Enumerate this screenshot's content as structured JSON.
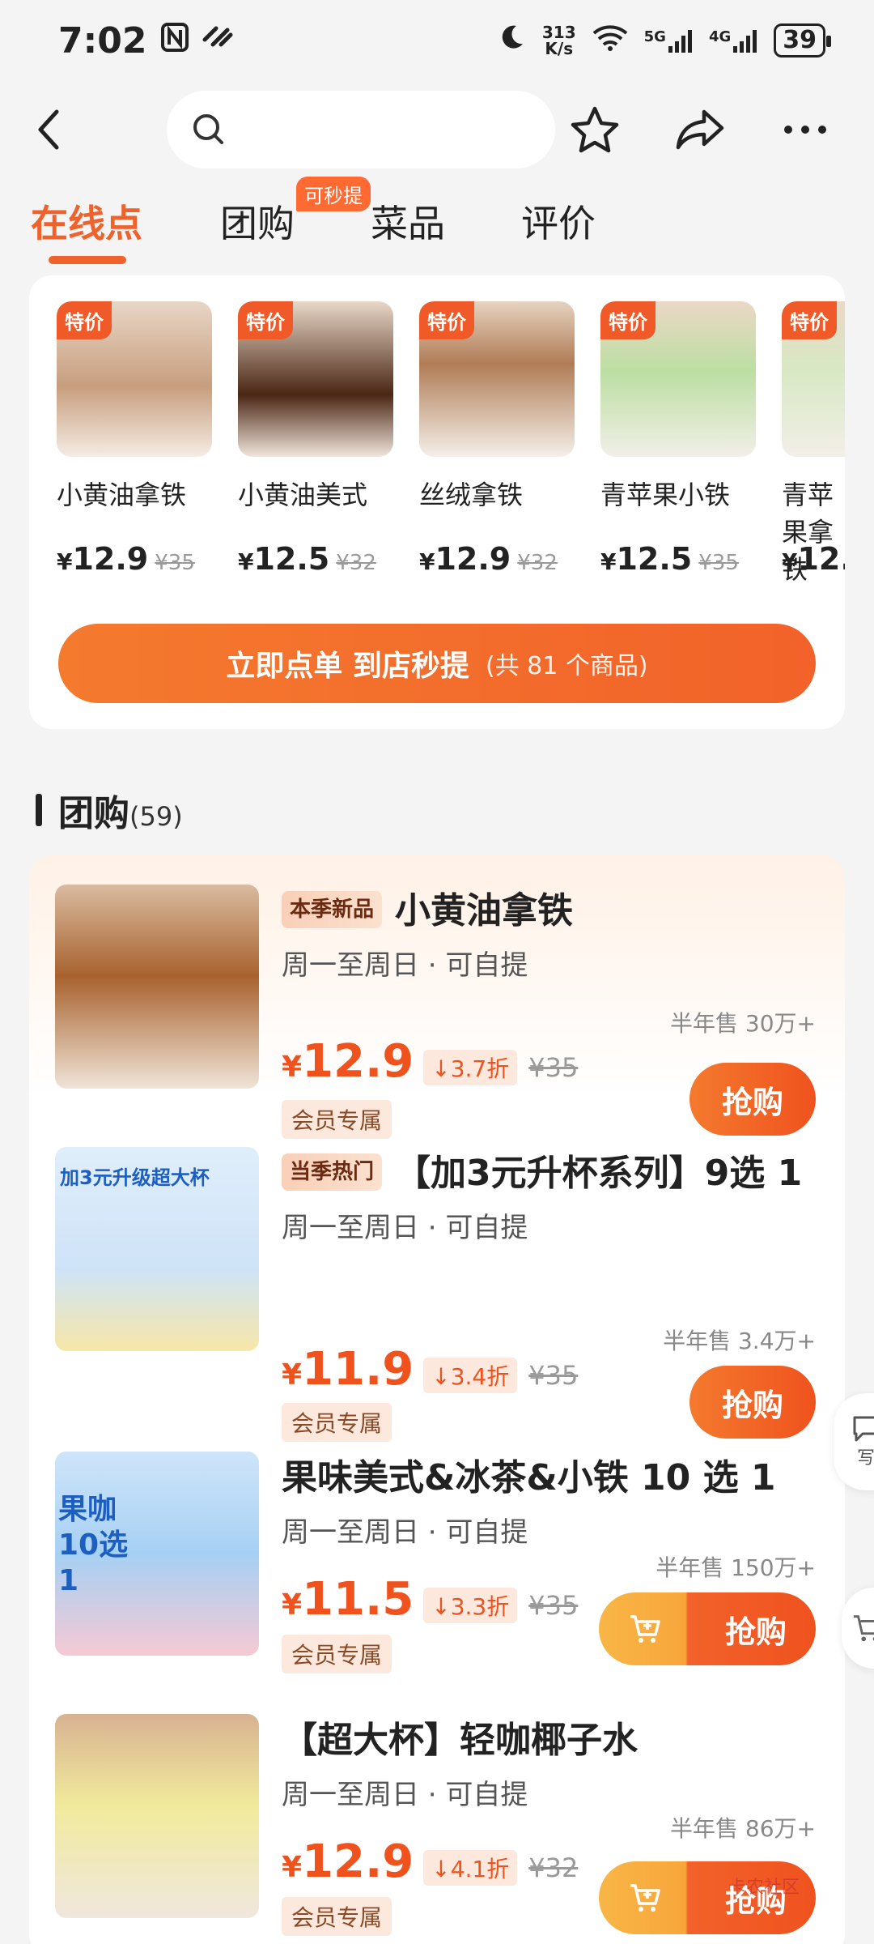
{
  "status": {
    "time": "7:02",
    "net_speed_top": "313",
    "net_speed_bottom": "K/s",
    "sig1": "5G",
    "sig2": "4G",
    "battery": "39"
  },
  "search": {
    "placeholder": ""
  },
  "tabs": [
    {
      "label": "在线点"
    },
    {
      "label": "团购"
    },
    {
      "label": "菜品"
    },
    {
      "label": "评价"
    }
  ],
  "tab_badge": "可秒提",
  "online": {
    "tag": "特价",
    "products": [
      {
        "name": "小黄油拿铁",
        "price": "12.9",
        "old": "¥35",
        "img_color": "#b7733b"
      },
      {
        "name": "小黄油美式",
        "price": "12.5",
        "old": "¥32",
        "img_color": "#6b3a1e"
      },
      {
        "name": "丝绒拿铁",
        "price": "12.9",
        "old": "¥32",
        "img_color": "#c9a98a"
      },
      {
        "name": "青苹果小铁",
        "price": "12.5",
        "old": "¥35",
        "img_color": "#bfe0a4"
      },
      {
        "name": "青苹果拿铁",
        "price": "12.",
        "old": "",
        "img_color": "#d7e7c2"
      }
    ],
    "button_main": "立即点单 到店秒提",
    "button_sub": "(共 81 个商品)"
  },
  "section": {
    "title": "团购",
    "count": "(59)"
  },
  "currency": "¥",
  "deals": [
    {
      "badge": "本季新品",
      "title": "小黄油拿铁",
      "sub": "周一至周日 · 可自提",
      "sold": "半年售 30万+",
      "price": "12.9",
      "discount": "3.7折",
      "old": "¥35",
      "member": "会员专属",
      "buy": "抢购"
    },
    {
      "badge": "当季热门",
      "title": "【加3元升杯系列】9选 1",
      "sub": "周一至周日 · 可自提",
      "sold": "半年售 3.4万+",
      "price": "11.9",
      "discount": "3.4折",
      "old": "¥35",
      "member": "会员专属",
      "buy": "抢购",
      "img_text": "加3元升级超大杯"
    },
    {
      "badge": "",
      "title": "果味美式&冰茶&小铁 10 选 1",
      "sub": "周一至周日 · 可自提",
      "sold": "半年售 150万+",
      "price": "11.5",
      "discount": "3.3折",
      "old": "¥35",
      "member": "会员专属",
      "buy": "抢购",
      "img_text": "果咖 10选1"
    },
    {
      "badge": "",
      "title": "【超大杯】轻咖椰子水",
      "sub": "周一至周日 · 可自提",
      "sold": "半年售 86万+",
      "price": "12.9",
      "discount": "4.1折",
      "old": "¥32",
      "member": "会员专属",
      "buy": "抢购"
    }
  ],
  "side_fab_label": "写",
  "watermark": "卡农社区",
  "colors": {
    "accent": "#f0622b",
    "price": "#f0521e"
  }
}
